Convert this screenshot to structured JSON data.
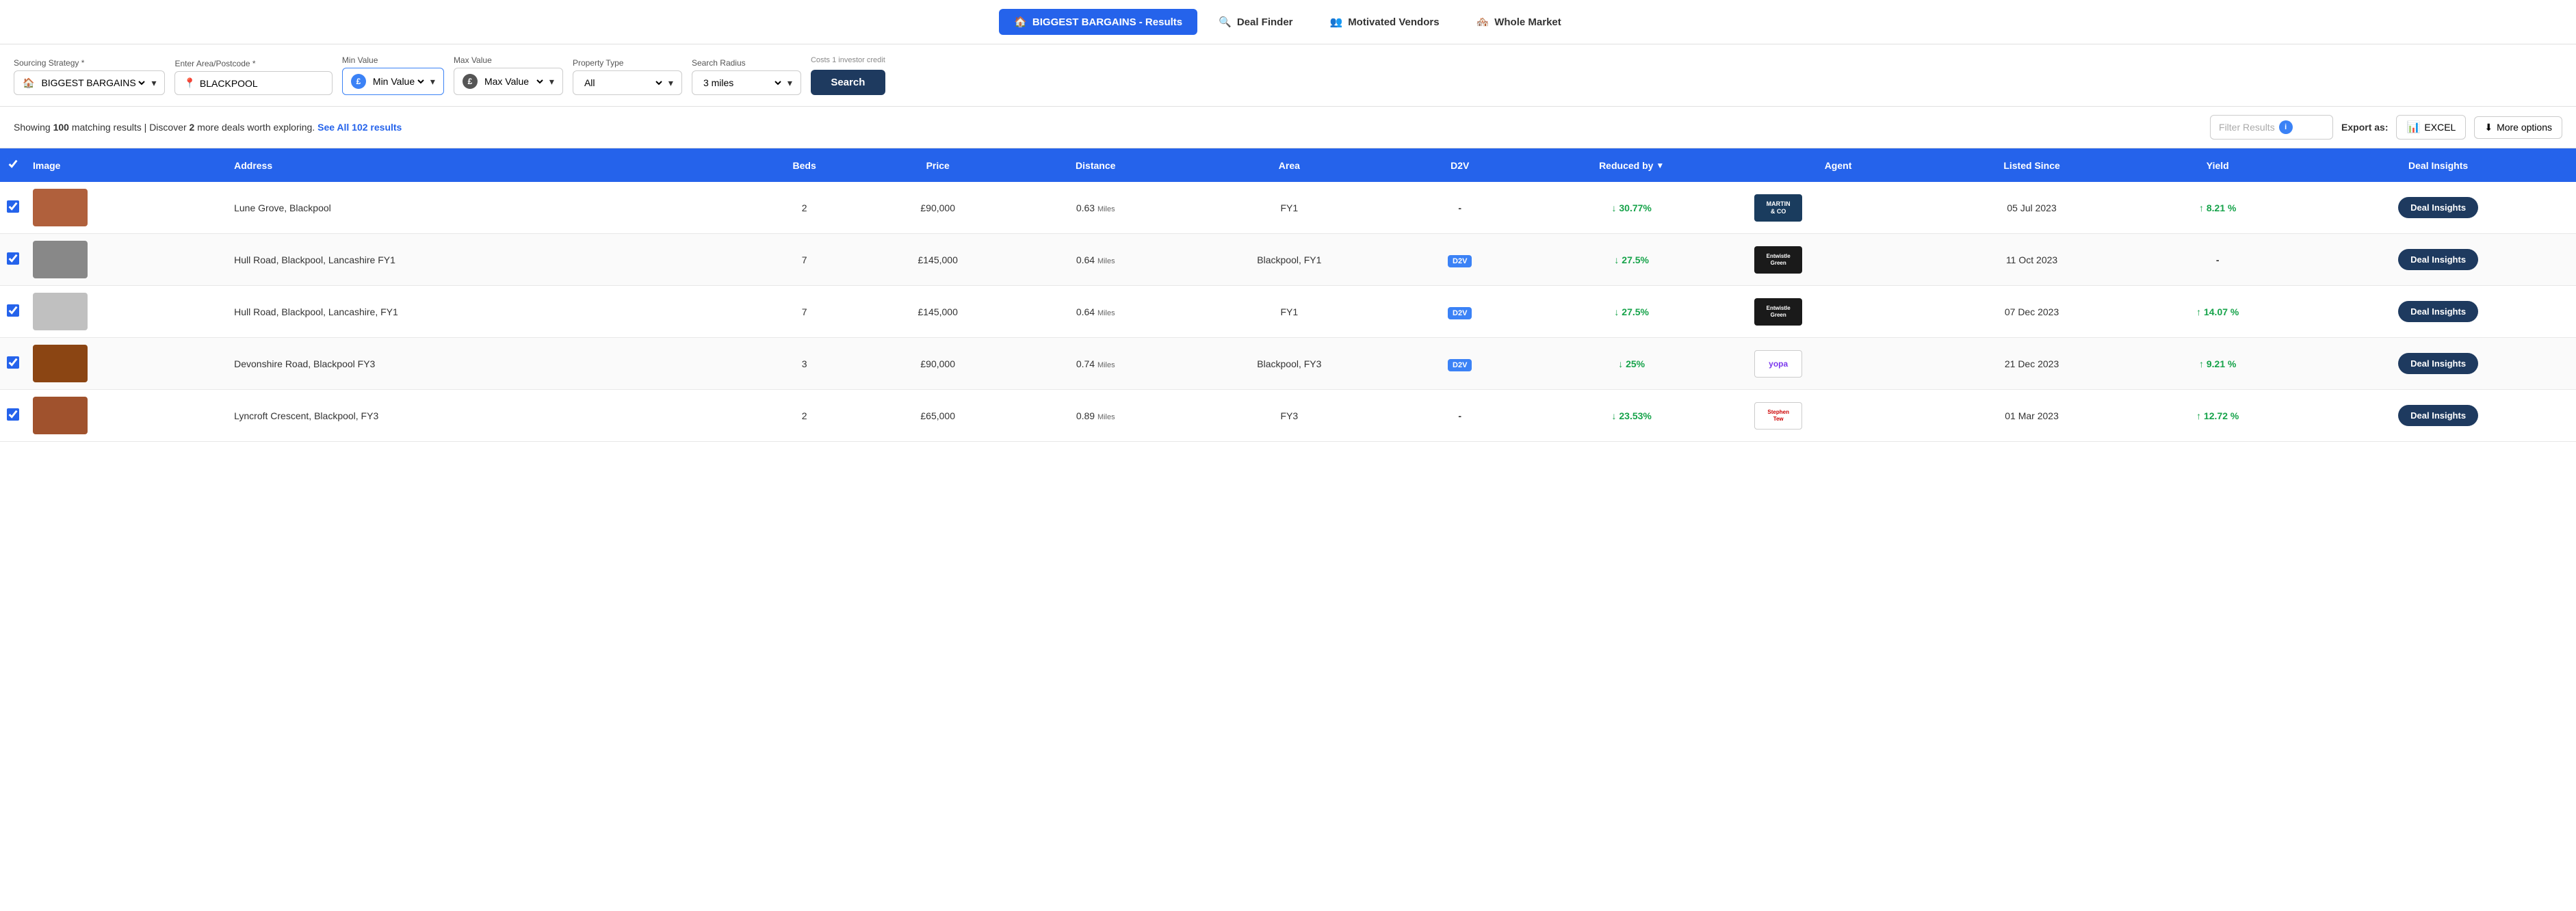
{
  "topNav": {
    "tabs": [
      {
        "id": "biggest-bargains",
        "label": "BIGGEST BARGAINS - Results",
        "active": true,
        "icon": "home"
      },
      {
        "id": "deal-finder",
        "label": "Deal Finder",
        "active": false,
        "icon": "search"
      },
      {
        "id": "motivated-vendors",
        "label": "Motivated Vendors",
        "active": false,
        "icon": "people"
      },
      {
        "id": "whole-market",
        "label": "Whole Market",
        "active": false,
        "icon": "market"
      }
    ]
  },
  "filters": {
    "sourcingStrategy": {
      "label": "Sourcing Strategy *",
      "value": "BIGGEST BARGAINS"
    },
    "areaPostcode": {
      "label": "Enter Area/Postcode *",
      "value": "BLACKPOOL"
    },
    "minValue": {
      "label": "Min Value",
      "placeholder": "Min Value"
    },
    "maxValue": {
      "label": "Max Value",
      "placeholder": "Max Value"
    },
    "propertyType": {
      "label": "Property Type",
      "value": "All"
    },
    "searchRadius": {
      "label": "Search Radius",
      "value": "3 miles"
    },
    "costNote": "Costs 1 investor credit",
    "searchButtonLabel": "Search"
  },
  "resultsBar": {
    "showing": "100",
    "moreDeals": "2",
    "seeAllText": "See All 102 results",
    "filterPlaceholder": "Filter Results",
    "exportLabel": "Export as:",
    "excelLabel": "EXCEL",
    "moreOptionsLabel": "More options"
  },
  "tableHeaders": {
    "checkbox": "",
    "image": "Image",
    "address": "Address",
    "beds": "Beds",
    "price": "Price",
    "distance": "Distance",
    "area": "Area",
    "d2v": "D2V",
    "reducedBy": "Reduced by",
    "agent": "Agent",
    "listedSince": "Listed Since",
    "yield": "Yield",
    "dealInsights": "Deal Insights"
  },
  "rows": [
    {
      "id": 1,
      "checked": true,
      "imgColor": "#b0603c",
      "address": "Lune Grove, Blackpool",
      "beds": "2",
      "price": "£90,000",
      "distance": "0.63",
      "distanceUnit": "Miles",
      "area": "FY1",
      "d2v": "-",
      "d2vBadge": false,
      "reducedBy": "30.77%",
      "agent": "MARTINS CO",
      "agentClass": "logo-martins",
      "listedSince": "05 Jul 2023",
      "yield": "8.21 %",
      "dealInsights": "Deal Insights"
    },
    {
      "id": 2,
      "checked": true,
      "imgColor": "#888",
      "address": "Hull Road, Blackpool, Lancashire FY1",
      "beds": "7",
      "price": "£145,000",
      "distance": "0.64",
      "distanceUnit": "Miles",
      "area": "Blackpool, FY1",
      "d2v": "D2V",
      "d2vBadge": true,
      "reducedBy": "27.5%",
      "agent": "ENTWISTLE GREEN",
      "agentClass": "logo-entwistle",
      "listedSince": "11 Oct 2023",
      "yield": "-",
      "dealInsights": "Deal Insights"
    },
    {
      "id": 3,
      "checked": true,
      "imgColor": "#c0c0c0",
      "address": "Hull Road, Blackpool, Lancashire, FY1",
      "beds": "7",
      "price": "£145,000",
      "distance": "0.64",
      "distanceUnit": "Miles",
      "area": "FY1",
      "d2v": "D2V",
      "d2vBadge": true,
      "reducedBy": "27.5%",
      "agent": "ENTWISTLE GREEN",
      "agentClass": "logo-entwistle",
      "listedSince": "07 Dec 2023",
      "yield": "14.07 %",
      "dealInsights": "Deal Insights"
    },
    {
      "id": 4,
      "checked": true,
      "imgColor": "#8b4513",
      "address": "Devonshire Road, Blackpool FY3",
      "beds": "3",
      "price": "£90,000",
      "distance": "0.74",
      "distanceUnit": "Miles",
      "area": "Blackpool, FY3",
      "d2v": "D2V",
      "d2vBadge": true,
      "reducedBy": "25%",
      "agent": "YOPA",
      "agentClass": "logo-yopa",
      "listedSince": "21 Dec 2023",
      "yield": "9.21 %",
      "dealInsights": "Deal Insights"
    },
    {
      "id": 5,
      "checked": true,
      "imgColor": "#a0522d",
      "address": "Lyncroft Crescent, Blackpool, FY3",
      "beds": "2",
      "price": "£65,000",
      "distance": "0.89",
      "distanceUnit": "Miles",
      "area": "FY3",
      "d2v": "-",
      "d2vBadge": false,
      "reducedBy": "23.53%",
      "agent": "STEPHEN TEW",
      "agentClass": "logo-stephen",
      "listedSince": "01 Mar 2023",
      "yield": "12.72 %",
      "dealInsights": "Deal Insights"
    }
  ]
}
